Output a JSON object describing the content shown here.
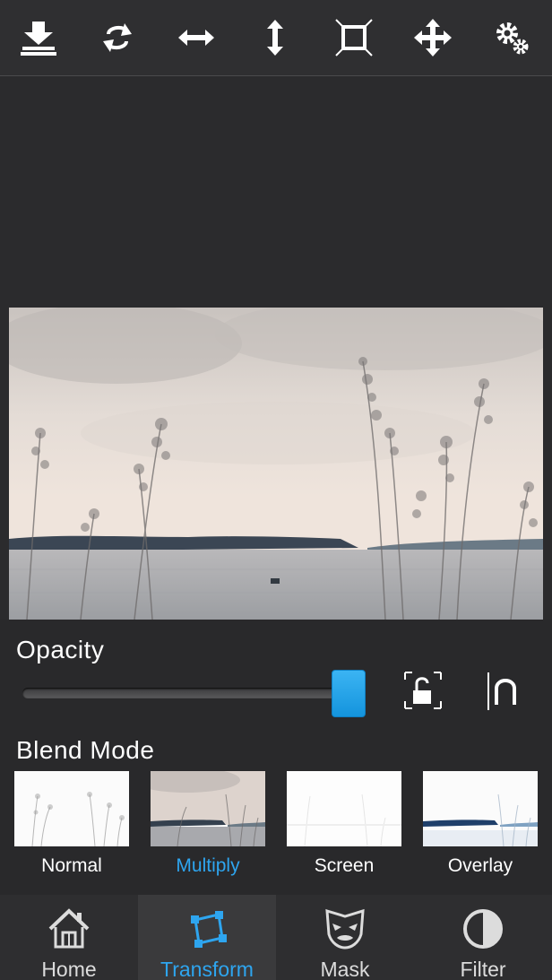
{
  "toolbar": {
    "buttons": [
      {
        "icon": "download-icon"
      },
      {
        "icon": "rotate-icon"
      },
      {
        "icon": "flip-horizontal-icon"
      },
      {
        "icon": "flip-vertical-icon"
      },
      {
        "icon": "fit-to-frame-icon"
      },
      {
        "icon": "move-icon"
      },
      {
        "icon": "settings-gears-icon"
      }
    ]
  },
  "controls": {
    "opacity_label": "Opacity",
    "opacity_level": 0.97,
    "lock_icon": "unlock-icon",
    "magnet_icon": "magnet-icon",
    "blend_mode_label": "Blend Mode",
    "blend_modes": [
      {
        "label": "Normal",
        "active": false
      },
      {
        "label": "Multiply",
        "active": true
      },
      {
        "label": "Screen",
        "active": false
      },
      {
        "label": "Overlay",
        "active": false
      }
    ]
  },
  "tabs": [
    {
      "label": "Home",
      "icon": "home-icon",
      "active": false
    },
    {
      "label": "Transform",
      "icon": "transform-icon",
      "active": true
    },
    {
      "label": "Mask",
      "icon": "mask-icon",
      "active": false
    },
    {
      "label": "Filter",
      "icon": "filter-icon",
      "active": false
    }
  ],
  "colors": {
    "accent": "#2ea5ef",
    "background": "#2b2b2d",
    "slider_thumb": "#1e9ee8"
  }
}
